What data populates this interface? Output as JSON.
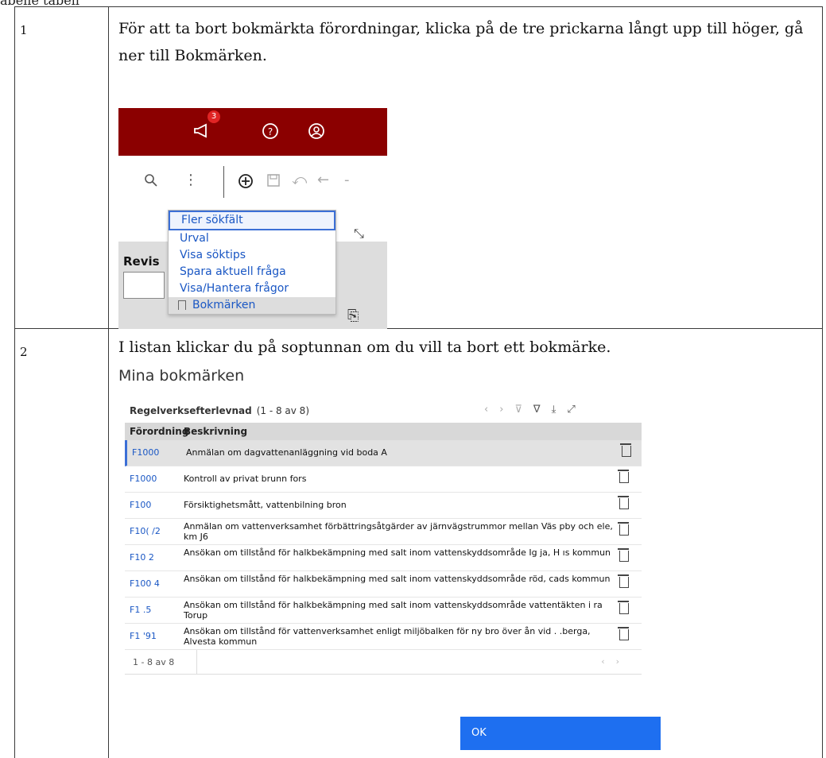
{
  "top_cut_text": "abelle tabell",
  "steps": [
    {
      "number": "1",
      "instruction": "För att ta bort bokmärkta förordningar, klicka på de tre prickarna långt upp till höger, gå ner till Bokmärken.",
      "screenshot": {
        "notification_count": "3",
        "menu_items": [
          "Fler sökfält",
          "Urval",
          "Visa söktips",
          "Spara aktuell fråga",
          "Visa/Hantera frågor",
          "Bokmärken"
        ],
        "field_label": "Revis"
      }
    },
    {
      "number": "2",
      "instruction": "I listan klickar du på soptunnan om du vill ta bort ett bokmärke.",
      "screenshot": {
        "title": "Mina bokmärken",
        "grid_title": "Regelverksefterlevnad",
        "grid_count": "(1 - 8 av 8)",
        "columns": [
          "Förordning",
          "Beskrivning"
        ],
        "rows": [
          {
            "code": "F1000",
            "desc": "Anmälan om dagvattenanläggning vid boda A"
          },
          {
            "code": "F1000",
            "desc": "Kontroll av privat brunn fors"
          },
          {
            "code": "F100",
            "desc": "Försiktighetsmått, vattenbilning bron"
          },
          {
            "code": "F10( /2",
            "desc": "Anmälan om vattenverksamhet förbättringsåtgärder av järnvägstrummor mellan Väs pby och ele, km J6"
          },
          {
            "code": "F10 2",
            "desc": "Ansökan om tillstånd för halkbekämpning med salt inom vattenskyddsområde Ig ja, H ıs kommun"
          },
          {
            "code": "F100 4",
            "desc": "Ansökan om tillstånd för halkbekämpning med salt inom vattenskyddsområde röd, cads kommun"
          },
          {
            "code": "F1 .5",
            "desc": "Ansökan om tillstånd för halkbekämpning med salt inom vattenskyddsområde vattentäkten i ra Torup"
          },
          {
            "code": "F1 '91",
            "desc": "Ansökan om tillstånd för vattenverksamhet enligt miljöbalken för ny bro över ån vid . .berga, Alvesta kommun"
          }
        ],
        "footer_text": "1 - 8 av 8",
        "ok_label": "OK"
      }
    }
  ]
}
